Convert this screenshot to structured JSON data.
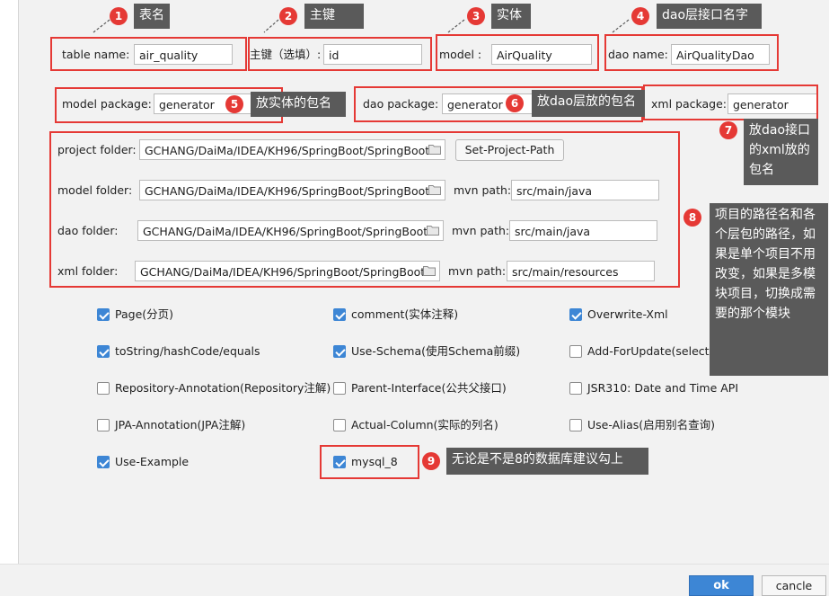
{
  "form": {
    "table_name_label": "table   name:",
    "table_name_value": "air_quality",
    "primary_key_label": "主键（选填）:",
    "primary_key_value": "id",
    "model_label": "model   :",
    "model_value": "AirQuality",
    "dao_name_label": "dao name:",
    "dao_name_value": "AirQualityDao",
    "model_package_label": "model package:",
    "model_package_value": "generator",
    "dao_package_label": "dao package:",
    "dao_package_value": "generator",
    "xml_package_label": "xml package:",
    "xml_package_value": "generator",
    "project_folder_label": "project folder:",
    "project_folder_value": "GCHANG/DaiMa/IDEA/KH96/SpringBoot/SpringBoot",
    "set_project_path_label": "Set-Project-Path",
    "model_folder_label": "model   folder:",
    "model_folder_value": "GCHANG/DaiMa/IDEA/KH96/SpringBoot/SpringBoot",
    "model_mvn_label": "mvn path:",
    "model_mvn_value": "src/main/java",
    "dao_folder_label": "dao     folder:",
    "dao_folder_value": "GCHANG/DaiMa/IDEA/KH96/SpringBoot/SpringBoot",
    "dao_mvn_label": "mvn path:",
    "dao_mvn_value": "src/main/java",
    "xml_folder_label": "xml     folder:",
    "xml_folder_value": "GCHANG/DaiMa/IDEA/KH96/SpringBoot/SpringBoot",
    "xml_mvn_label": "mvn path:",
    "xml_mvn_value": "src/main/resources"
  },
  "options": [
    {
      "label": "Page(分页)",
      "checked": true
    },
    {
      "label": "comment(实体注释)",
      "checked": true
    },
    {
      "label": "Overwrite-Xml",
      "checked": true
    },
    {
      "label": "toString/hashCode/equals",
      "checked": true
    },
    {
      "label": "Use-Schema(使用Schema前缀)",
      "checked": true
    },
    {
      "label": "Add-ForUpdate(select增加ForUpdate)",
      "checked": false
    },
    {
      "label": "Repository-Annotation(Repository注解)",
      "checked": false
    },
    {
      "label": "Parent-Interface(公共父接口)",
      "checked": false
    },
    {
      "label": "JSR310: Date and Time API",
      "checked": false
    },
    {
      "label": "JPA-Annotation(JPA注解)",
      "checked": false
    },
    {
      "label": "Actual-Column(实际的列名)",
      "checked": false
    },
    {
      "label": "Use-Alias(启用别名查询)",
      "checked": false
    },
    {
      "label": "Use-Example",
      "checked": true
    },
    {
      "label": "mysql_8",
      "checked": true
    }
  ],
  "annotations": {
    "n1": "1",
    "c1": "表名",
    "n2": "2",
    "c2": "主键",
    "n3": "3",
    "c3": "实体",
    "n4": "4",
    "c4": "dao层接口名字",
    "n5": "5",
    "c5": "放实体的包名",
    "n6": "6",
    "c6": "放dao层放的包名",
    "n7": "7",
    "c7": "放dao接口的xml放的包名",
    "n8": "8",
    "c8": "项目的路径名和各个层包的路径，如果是单个项目不用改变，如果是多模块项目，切换成需要的那个模块",
    "n9": "9",
    "c9": "无论是不是8的数据库建议勾上"
  },
  "footer": {
    "ok_label": "ok",
    "cancel_label": "cancle"
  },
  "colors": {
    "accent": "#3d86d5",
    "annotation_red": "#e53935",
    "callout_bg": "#5a5a5a",
    "window_bg": "#f2f2f2"
  }
}
